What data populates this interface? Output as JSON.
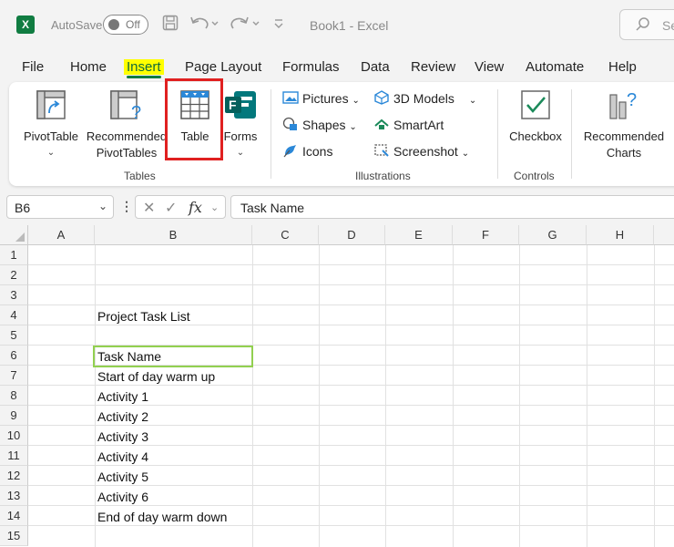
{
  "titlebar": {
    "app_logo": "X",
    "autosave_label": "AutoSave",
    "autosave_state": "Off",
    "doc_title": "Book1  -  Excel",
    "search_placeholder": "Se",
    "icons": [
      "excel-logo-icon",
      "save-icon",
      "undo-icon",
      "redo-icon",
      "customize-qat-icon",
      "search-icon"
    ]
  },
  "menu": {
    "items": [
      "File",
      "Home",
      "Insert",
      "Page Layout",
      "Formulas",
      "Data",
      "Review",
      "View",
      "Automate",
      "Help"
    ],
    "active": "Insert"
  },
  "ribbon": {
    "tables_group": {
      "label": "Tables",
      "pivottable": "PivotTable",
      "recommended_pivot_line1": "Recommended",
      "recommended_pivot_line2": "PivotTables",
      "table": "Table",
      "forms": "Forms"
    },
    "illustrations_group": {
      "label": "Illustrations",
      "pictures": "Pictures",
      "shapes": "Shapes",
      "icons": "Icons",
      "models_3d": "3D Models",
      "smartart": "SmartArt",
      "screenshot": "Screenshot"
    },
    "controls_group": {
      "label": "Controls",
      "checkbox": "Checkbox"
    },
    "charts": {
      "recommended_line1": "Recommended",
      "recommended_line2": "Charts"
    },
    "highlight_color": "#e02020"
  },
  "formula_bar": {
    "name_box": "B6",
    "fx": "fx",
    "content": "Task Name"
  },
  "grid": {
    "columns": [
      "A",
      "B",
      "C",
      "D",
      "E",
      "F",
      "G",
      "H"
    ],
    "rows": [
      "1",
      "2",
      "3",
      "4",
      "5",
      "6",
      "7",
      "8",
      "9",
      "10",
      "11",
      "12",
      "13",
      "14",
      "15"
    ],
    "selected_cell": "B6",
    "cells": {
      "B4": "Project Task List",
      "B6": "Task Name",
      "B7": "Start of day warm up",
      "B8": "Activity 1",
      "B9": "Activity 2",
      "B10": "Activity 3",
      "B11": "Activity 4",
      "B12": "Activity 5",
      "B13": "Activity 6",
      "B14": "End of day warm down"
    }
  },
  "colors": {
    "excel_green": "#107c41",
    "menu_highlight": "#ffff00",
    "selection_border": "#92d050"
  }
}
